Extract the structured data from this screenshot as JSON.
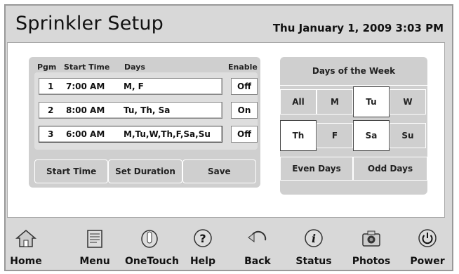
{
  "header": {
    "title": "Sprinkler Setup",
    "datetime": "Thu January 1, 2009  3:03 PM"
  },
  "programs": {
    "col_pgm": "Pgm",
    "col_start": "Start Time",
    "col_days": "Days",
    "col_enable": "Enable",
    "rows": [
      {
        "pgm": "1",
        "start": "7:00 AM",
        "days": "M, F",
        "enable": "Off"
      },
      {
        "pgm": "2",
        "start": "8:00 AM",
        "days": "Tu, Th, Sa",
        "enable": "On"
      },
      {
        "pgm": "3",
        "start": "6:00 AM",
        "days": "M,Tu,W,Th,F,Sa,Su",
        "enable": "Off"
      }
    ],
    "buttons": {
      "start_time": "Start Time",
      "set_duration": "Set Duration",
      "save": "Save"
    }
  },
  "days_panel": {
    "title": "Days of the Week",
    "all": "All",
    "m": "M",
    "tu": "Tu",
    "w": "W",
    "th": "Th",
    "f": "F",
    "sa": "Sa",
    "su": "Su",
    "even": "Even Days",
    "odd": "Odd Days",
    "selected": [
      "Tu",
      "Th",
      "Sa"
    ]
  },
  "toolbar": {
    "home": "Home",
    "menu": "Menu",
    "onetouch": "OneTouch",
    "help": "Help",
    "back": "Back",
    "status": "Status",
    "photos": "Photos",
    "power": "Power"
  }
}
